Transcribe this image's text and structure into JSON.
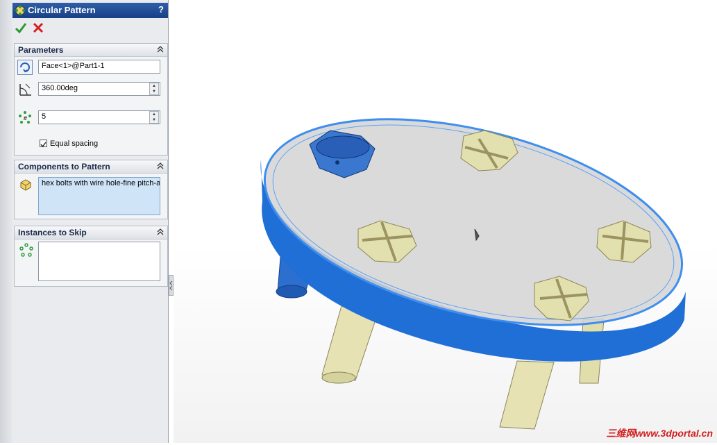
{
  "window": {
    "title": "Circular Pattern",
    "help": "?"
  },
  "actions": {
    "ok": "✔",
    "cancel": "✖"
  },
  "parameters": {
    "header": "Parameters",
    "axis_value": "Face<1>@Part1-1",
    "angle_value": "360.00deg",
    "instances_value": "5",
    "equal_spacing_label": "Equal spacing",
    "equal_spacing_checked": true
  },
  "components": {
    "header": "Components to Pattern",
    "items": [
      "hex bolts with wire hole-fine pitch-a"
    ]
  },
  "skip": {
    "header": "Instances to Skip",
    "items": []
  },
  "watermark": "三维网www.3dportal.cn",
  "colors": {
    "title_bar": "#173f86",
    "plate_edge": "#1f6fd6",
    "plate_face": "#d3d3d3",
    "bolt": "#e3e0b0",
    "selected_bolt": "#3a78d0",
    "leg": "#e6e2b4"
  }
}
